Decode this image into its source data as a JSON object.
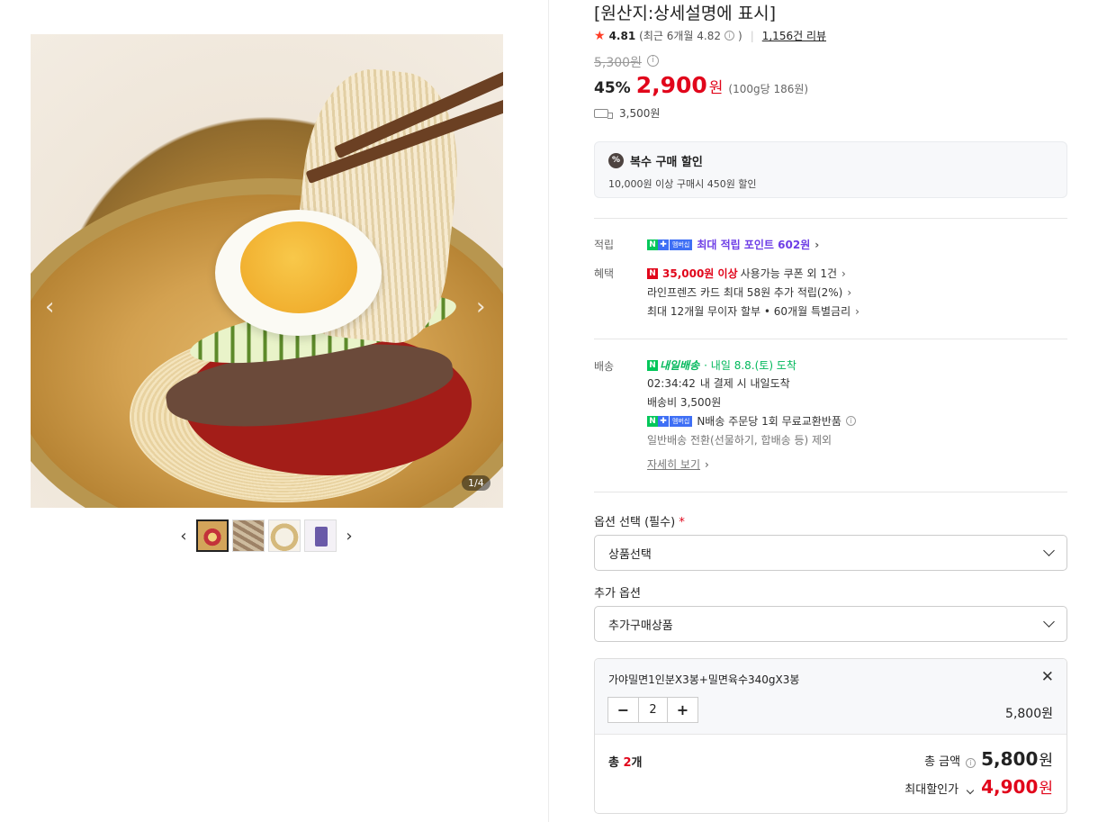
{
  "gallery": {
    "counter": "1/4",
    "thumbnails": [
      "thumb-1",
      "thumb-2",
      "thumb-3",
      "thumb-4"
    ]
  },
  "product": {
    "origin": "[원산지:상세설명에 표시]",
    "rating": "4.81",
    "recent_rating": "(최근 6개월 4.82",
    "recent_rating_end": ")",
    "review_count": "1,156건 리뷰",
    "original_price": "5,300원",
    "discount_rate": "45%",
    "sale_price": "2,900",
    "currency": "원",
    "unit_price": "(100g당 186원)",
    "shipping_fee": "3,500원"
  },
  "bulk_discount": {
    "title": "복수 구매 할인",
    "icon_text": "%",
    "description": "10,000원 이상 구매시 450원 할인"
  },
  "benefits": {
    "points_label": "적립",
    "points_text": "최대 적립 포인트 602원",
    "benefit_label": "혜택",
    "coupon_amount": "35,000원 이상",
    "coupon_text": "사용가능 쿠폰 외 1건",
    "card_text": "라인프렌즈 카드 최대 58원 추가 적립(2%)",
    "installment_text": "최대 12개월 무이자 할부 • 60개월 특별금리",
    "npay_n": "N",
    "npay_plus": "✚",
    "npay_membership": "멤버십"
  },
  "delivery": {
    "label": "배송",
    "badge": "내일배송",
    "arrival": "· 내일 8.8.(토) 도착",
    "countdown": "02:34:42",
    "countdown_text": "내 결제 시 내일도착",
    "fee": "배송비 3,500원",
    "return_text": "N배송 주문당 1회 무료교환반품",
    "exclusion": "일반배송 전환(선물하기, 합배송 등) 제외",
    "detail_link": "자세히 보기"
  },
  "options": {
    "required_label": "옵션 선택 (필수)",
    "required_mark": "*",
    "required_placeholder": "상품선택",
    "extra_label": "추가 옵션",
    "extra_placeholder": "추가구매상품"
  },
  "selection": {
    "item_name": "가야밀면1인분X3봉+밀면육수340gX3봉",
    "quantity": "2",
    "item_price": "5,800원",
    "total_prefix": "총 ",
    "total_count": "2",
    "total_suffix": "개",
    "total_label": "총 금액",
    "total_amount": "5,800",
    "currency": "원",
    "max_discount_label": "최대할인가",
    "max_discount_amount": "4,900"
  },
  "colors": {
    "accent_red": "#e1061b",
    "naver_green": "#03c75a",
    "membership_blue": "#3e6ff5",
    "points_purple": "#6e3ee6"
  }
}
